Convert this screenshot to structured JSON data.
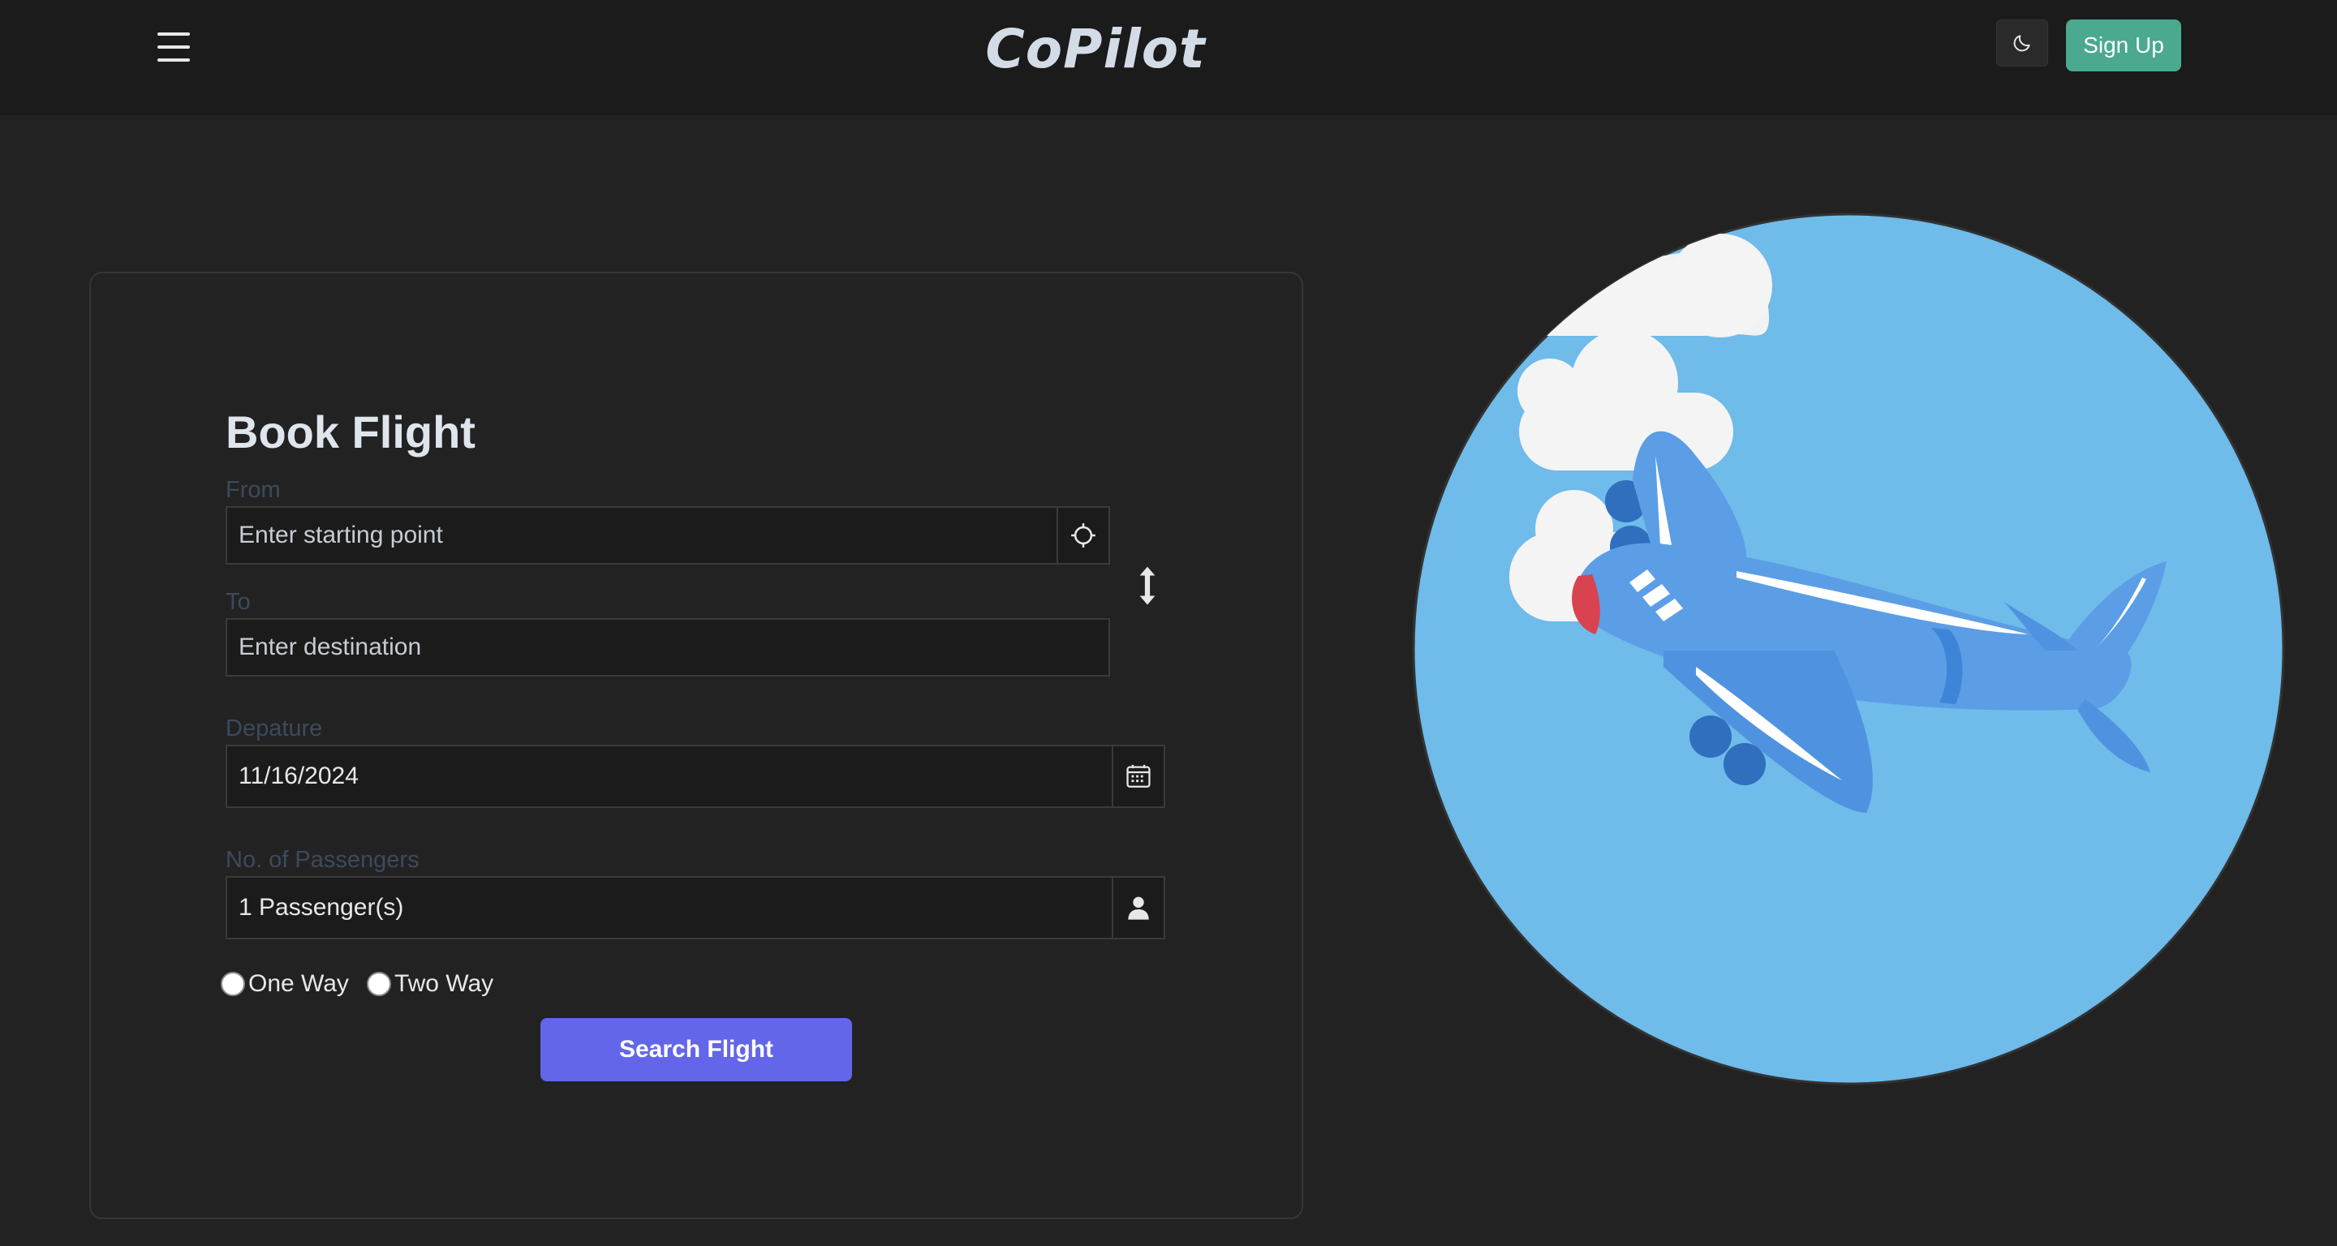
{
  "header": {
    "brand": "CoPilot",
    "signup_label": "Sign Up",
    "menu_icon": "hamburger-menu-icon",
    "theme_icon": "moon-icon"
  },
  "form": {
    "title": "Book Flight",
    "from": {
      "label": "From",
      "placeholder": "Enter starting point",
      "value": "",
      "icon": "crosshair-icon"
    },
    "swap_icon": "swap-vertical-icon",
    "to": {
      "label": "To",
      "placeholder": "Enter destination",
      "value": ""
    },
    "departure": {
      "label": "Depature",
      "value": "11/16/2024",
      "icon": "calendar-icon"
    },
    "passengers": {
      "label": "No. of Passengers",
      "value": "1 Passenger(s)",
      "icon": "person-icon"
    },
    "trip_types": [
      {
        "label": "One Way",
        "checked": false
      },
      {
        "label": "Two Way",
        "checked": false
      }
    ],
    "submit_label": "Search Flight"
  },
  "colors": {
    "background": "#222222",
    "header_background": "#1b1b1b",
    "accent_signup": "#4aa98f",
    "accent_search": "#6366e8",
    "sky": "#6fbbea",
    "plane": "#5b9ee6",
    "plane_nose": "#d9434f"
  }
}
